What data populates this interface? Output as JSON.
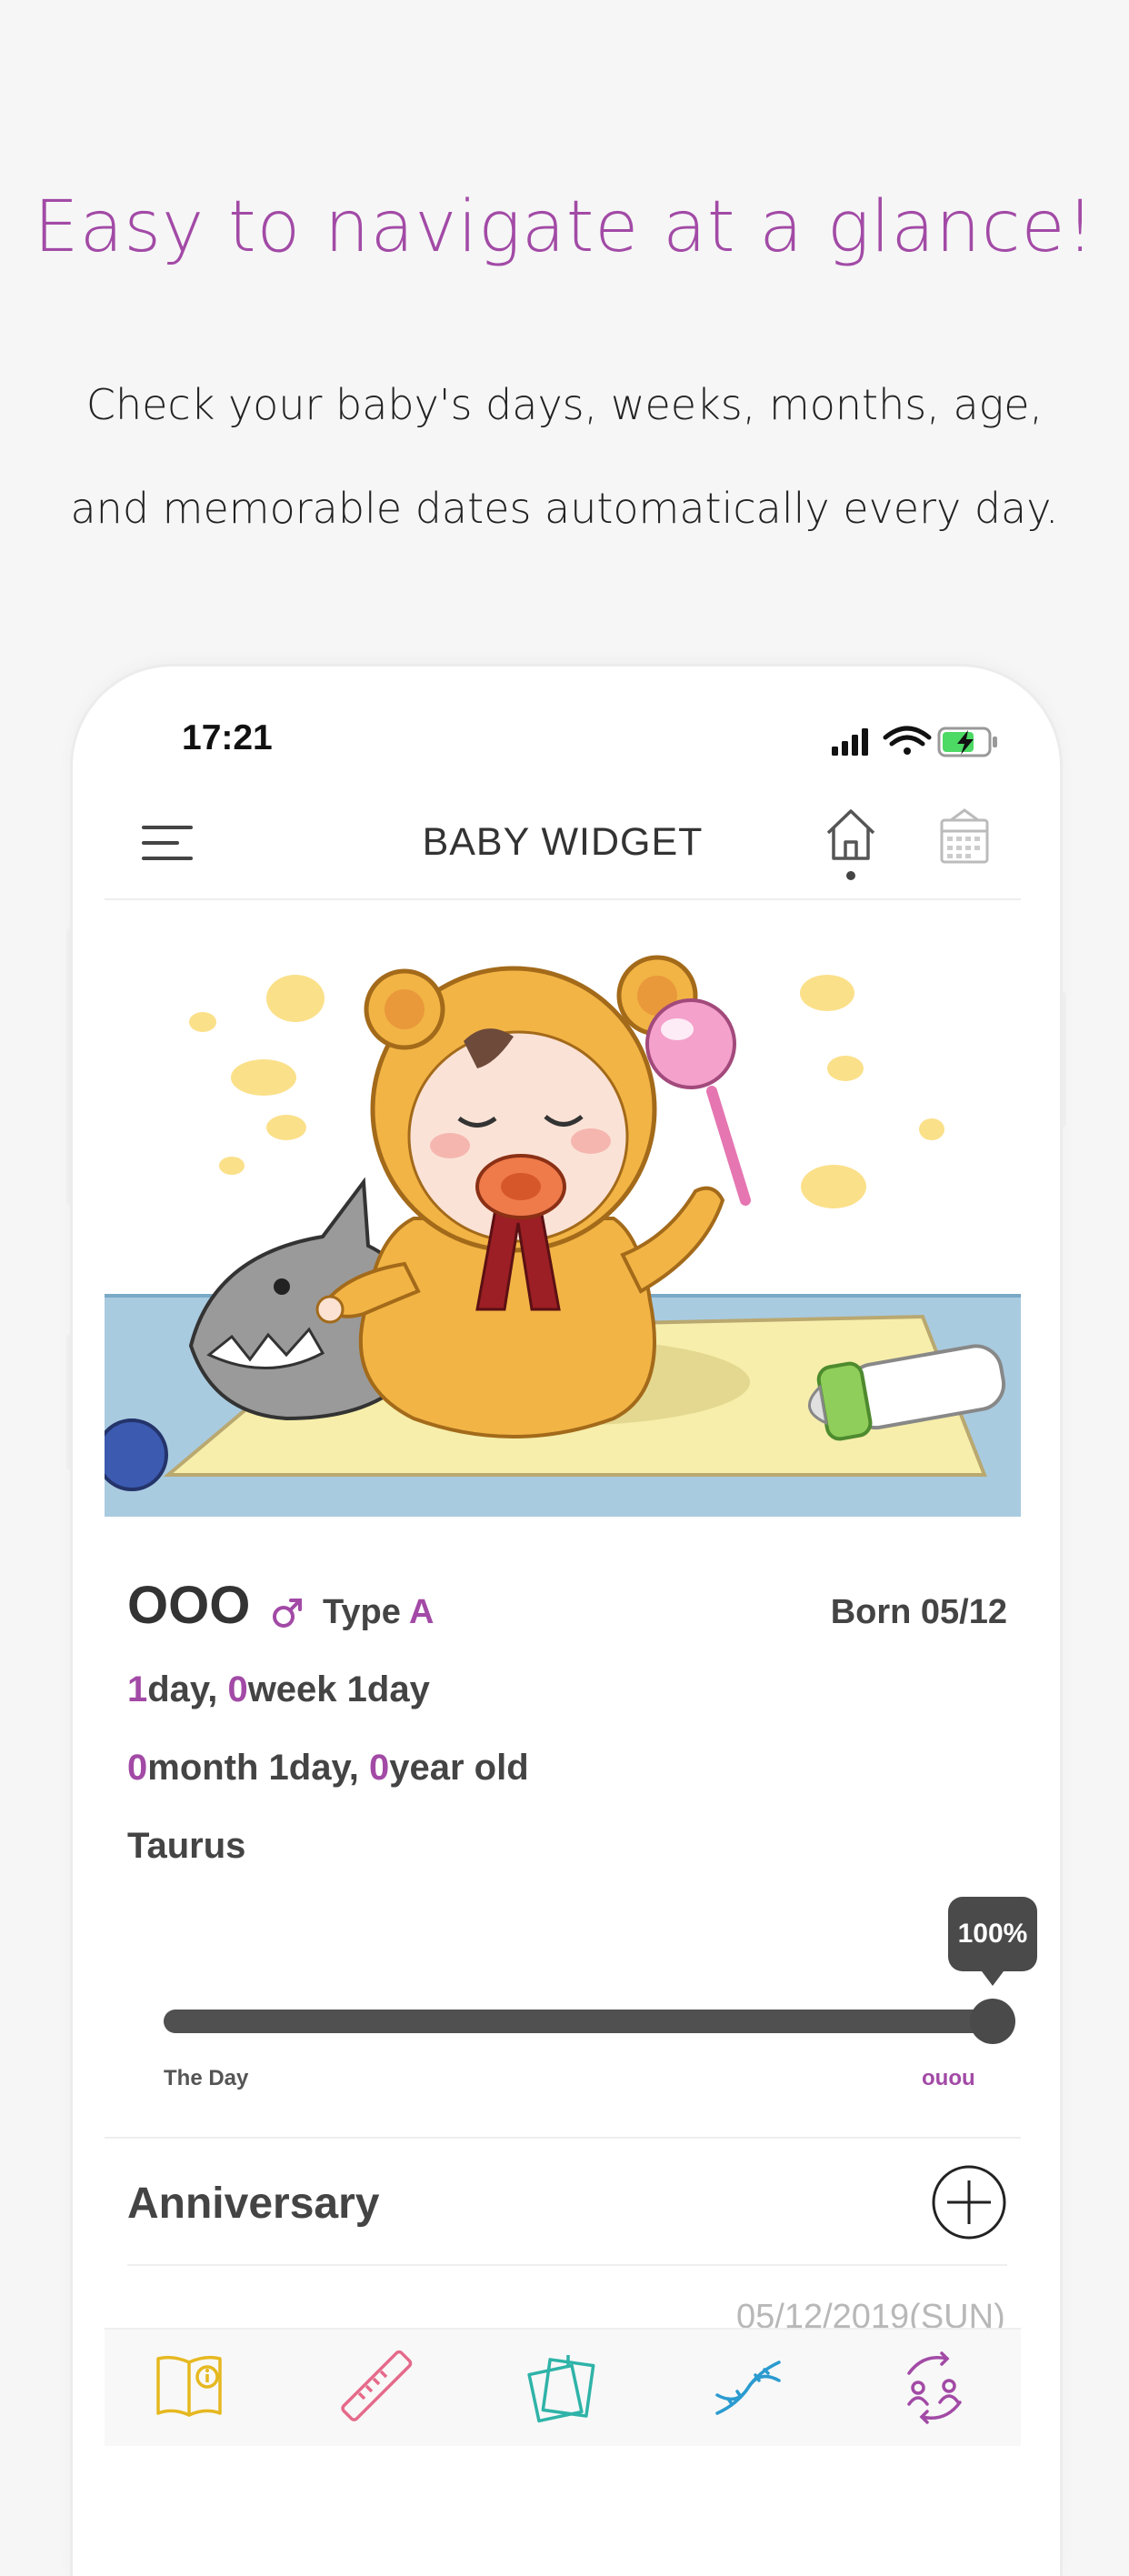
{
  "promo": {
    "headline": "Easy to navigate at a glance!",
    "subline_1": "Check your baby's days, weeks, months, age,",
    "subline_2": "and memorable dates automatically every day."
  },
  "status_bar": {
    "time": "17:21"
  },
  "app_bar": {
    "title": "BABY WIDGET"
  },
  "baby": {
    "name": "OOO",
    "type_label": "Type ",
    "blood_type": "A",
    "born": "Born 05/12",
    "days_num": "1",
    "days_text": "day, ",
    "weeks_num": "0",
    "weeks_text": "week 1day",
    "months_num": "0",
    "months_text": "month 1day, ",
    "years_num": "0",
    "years_text": "year old",
    "zodiac": "Taurus"
  },
  "progress": {
    "percent_label": "100%",
    "fraction": 1.0,
    "start_label": "The Day",
    "end_label": "ouou"
  },
  "anniversary": {
    "title": "Anniversary",
    "first_date": "05/12/2019(SUN)"
  },
  "tabs": [
    "book-info-icon",
    "ruler-icon",
    "notes-icon",
    "dna-icon",
    "family-sync-icon"
  ],
  "colors": {
    "accent": "#a24aa6",
    "tab_book": "#e6b820",
    "tab_ruler": "#e56a8a",
    "tab_notes": "#2fb3a8",
    "tab_dna": "#2b9bd0",
    "tab_family": "#a24aa6"
  }
}
